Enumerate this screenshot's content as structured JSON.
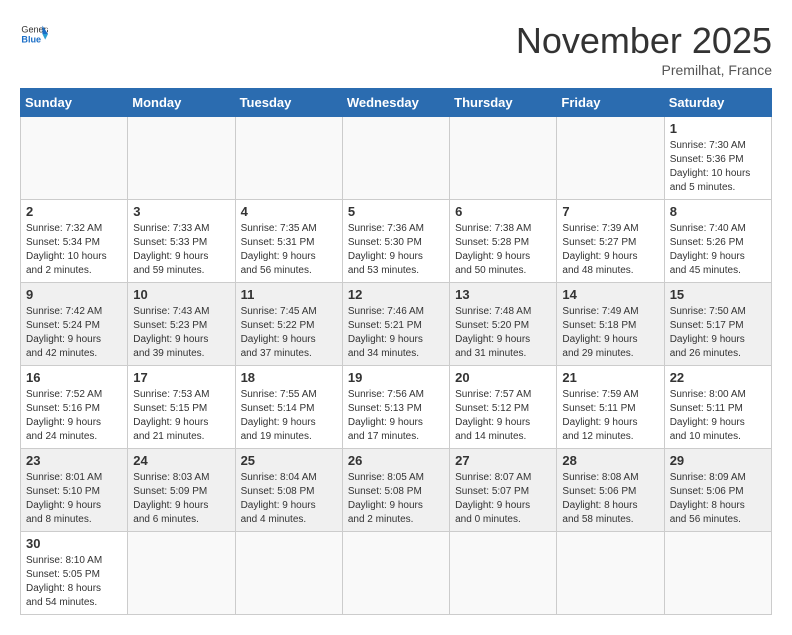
{
  "header": {
    "logo_general": "General",
    "logo_blue": "Blue",
    "title": "November 2025",
    "subtitle": "Premilhat, France"
  },
  "columns": [
    "Sunday",
    "Monday",
    "Tuesday",
    "Wednesday",
    "Thursday",
    "Friday",
    "Saturday"
  ],
  "weeks": [
    [
      {
        "day": "",
        "info": ""
      },
      {
        "day": "",
        "info": ""
      },
      {
        "day": "",
        "info": ""
      },
      {
        "day": "",
        "info": ""
      },
      {
        "day": "",
        "info": ""
      },
      {
        "day": "",
        "info": ""
      },
      {
        "day": "1",
        "info": "Sunrise: 7:30 AM\nSunset: 5:36 PM\nDaylight: 10 hours\nand 5 minutes."
      }
    ],
    [
      {
        "day": "2",
        "info": "Sunrise: 7:32 AM\nSunset: 5:34 PM\nDaylight: 10 hours\nand 2 minutes."
      },
      {
        "day": "3",
        "info": "Sunrise: 7:33 AM\nSunset: 5:33 PM\nDaylight: 9 hours\nand 59 minutes."
      },
      {
        "day": "4",
        "info": "Sunrise: 7:35 AM\nSunset: 5:31 PM\nDaylight: 9 hours\nand 56 minutes."
      },
      {
        "day": "5",
        "info": "Sunrise: 7:36 AM\nSunset: 5:30 PM\nDaylight: 9 hours\nand 53 minutes."
      },
      {
        "day": "6",
        "info": "Sunrise: 7:38 AM\nSunset: 5:28 PM\nDaylight: 9 hours\nand 50 minutes."
      },
      {
        "day": "7",
        "info": "Sunrise: 7:39 AM\nSunset: 5:27 PM\nDaylight: 9 hours\nand 48 minutes."
      },
      {
        "day": "8",
        "info": "Sunrise: 7:40 AM\nSunset: 5:26 PM\nDaylight: 9 hours\nand 45 minutes."
      }
    ],
    [
      {
        "day": "9",
        "info": "Sunrise: 7:42 AM\nSunset: 5:24 PM\nDaylight: 9 hours\nand 42 minutes."
      },
      {
        "day": "10",
        "info": "Sunrise: 7:43 AM\nSunset: 5:23 PM\nDaylight: 9 hours\nand 39 minutes."
      },
      {
        "day": "11",
        "info": "Sunrise: 7:45 AM\nSunset: 5:22 PM\nDaylight: 9 hours\nand 37 minutes."
      },
      {
        "day": "12",
        "info": "Sunrise: 7:46 AM\nSunset: 5:21 PM\nDaylight: 9 hours\nand 34 minutes."
      },
      {
        "day": "13",
        "info": "Sunrise: 7:48 AM\nSunset: 5:20 PM\nDaylight: 9 hours\nand 31 minutes."
      },
      {
        "day": "14",
        "info": "Sunrise: 7:49 AM\nSunset: 5:18 PM\nDaylight: 9 hours\nand 29 minutes."
      },
      {
        "day": "15",
        "info": "Sunrise: 7:50 AM\nSunset: 5:17 PM\nDaylight: 9 hours\nand 26 minutes."
      }
    ],
    [
      {
        "day": "16",
        "info": "Sunrise: 7:52 AM\nSunset: 5:16 PM\nDaylight: 9 hours\nand 24 minutes."
      },
      {
        "day": "17",
        "info": "Sunrise: 7:53 AM\nSunset: 5:15 PM\nDaylight: 9 hours\nand 21 minutes."
      },
      {
        "day": "18",
        "info": "Sunrise: 7:55 AM\nSunset: 5:14 PM\nDaylight: 9 hours\nand 19 minutes."
      },
      {
        "day": "19",
        "info": "Sunrise: 7:56 AM\nSunset: 5:13 PM\nDaylight: 9 hours\nand 17 minutes."
      },
      {
        "day": "20",
        "info": "Sunrise: 7:57 AM\nSunset: 5:12 PM\nDaylight: 9 hours\nand 14 minutes."
      },
      {
        "day": "21",
        "info": "Sunrise: 7:59 AM\nSunset: 5:11 PM\nDaylight: 9 hours\nand 12 minutes."
      },
      {
        "day": "22",
        "info": "Sunrise: 8:00 AM\nSunset: 5:11 PM\nDaylight: 9 hours\nand 10 minutes."
      }
    ],
    [
      {
        "day": "23",
        "info": "Sunrise: 8:01 AM\nSunset: 5:10 PM\nDaylight: 9 hours\nand 8 minutes."
      },
      {
        "day": "24",
        "info": "Sunrise: 8:03 AM\nSunset: 5:09 PM\nDaylight: 9 hours\nand 6 minutes."
      },
      {
        "day": "25",
        "info": "Sunrise: 8:04 AM\nSunset: 5:08 PM\nDaylight: 9 hours\nand 4 minutes."
      },
      {
        "day": "26",
        "info": "Sunrise: 8:05 AM\nSunset: 5:08 PM\nDaylight: 9 hours\nand 2 minutes."
      },
      {
        "day": "27",
        "info": "Sunrise: 8:07 AM\nSunset: 5:07 PM\nDaylight: 9 hours\nand 0 minutes."
      },
      {
        "day": "28",
        "info": "Sunrise: 8:08 AM\nSunset: 5:06 PM\nDaylight: 8 hours\nand 58 minutes."
      },
      {
        "day": "29",
        "info": "Sunrise: 8:09 AM\nSunset: 5:06 PM\nDaylight: 8 hours\nand 56 minutes."
      }
    ],
    [
      {
        "day": "30",
        "info": "Sunrise: 8:10 AM\nSunset: 5:05 PM\nDaylight: 8 hours\nand 54 minutes."
      },
      {
        "day": "",
        "info": ""
      },
      {
        "day": "",
        "info": ""
      },
      {
        "day": "",
        "info": ""
      },
      {
        "day": "",
        "info": ""
      },
      {
        "day": "",
        "info": ""
      },
      {
        "day": "",
        "info": ""
      }
    ]
  ]
}
